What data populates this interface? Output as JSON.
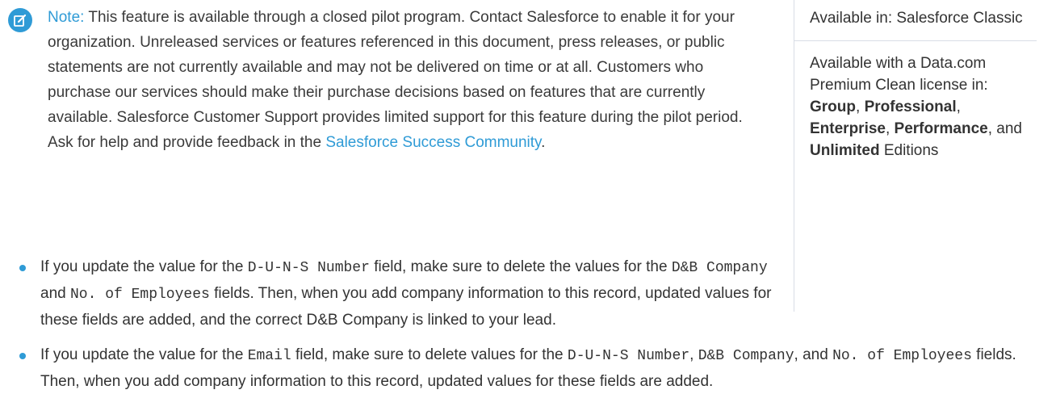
{
  "note": {
    "label": "Note:",
    "text": " This feature is available through a closed pilot program. Contact Salesforce to enable it for your organization. Unreleased services or features referenced in this document, press releases, or public statements are not currently available and may not be delivered on time or at all. Customers who purchase our services should make their purchase decisions based on features that are currently available. Salesforce Customer Support provides limited support for this feature during the pilot period. Ask for help and provide feedback in the ",
    "link_text": "Salesforce Success Community",
    "end": "."
  },
  "sidebar": {
    "availability": "Available in: Salesforce Classic",
    "license_intro": "Available with a Data.com Premium Clean license in:",
    "editions": [
      "Group",
      "Professional",
      "Enterprise",
      "Performance",
      "Unlimited"
    ],
    "sep1": ", ",
    "sep2": ", ",
    "sep3": ", ",
    "sep4": ", and ",
    "editions_suffix": " Editions"
  },
  "bullets": {
    "b1": {
      "t1": "If you update the value for the ",
      "c1": "D-U-N-S Number",
      "t2": " field, make sure to delete the values for the ",
      "c2": "D&B Company",
      "t3": " and ",
      "c3": "No. of Employees",
      "t4": " fields. Then, when you add company information to this record, updated values for these fields are added, and the correct D&B Company is linked to your lead."
    },
    "b2": {
      "t1": "If you update the value for the ",
      "c1": "Email",
      "t2": " field, make sure to delete values for the ",
      "c2": "D-U-N-S Number",
      "t3": ", ",
      "c3": "D&B Company",
      "t4": ", and ",
      "c4": "No. of Employees",
      "t5": " fields. Then, when you add company information to this record, updated values for these fields are added."
    }
  },
  "colors": {
    "accent": "#2f9bd6",
    "text": "#333333",
    "divider": "#d8dde6"
  },
  "icons": {
    "note": "edit-note-icon",
    "bullet": "bullet-dot"
  }
}
